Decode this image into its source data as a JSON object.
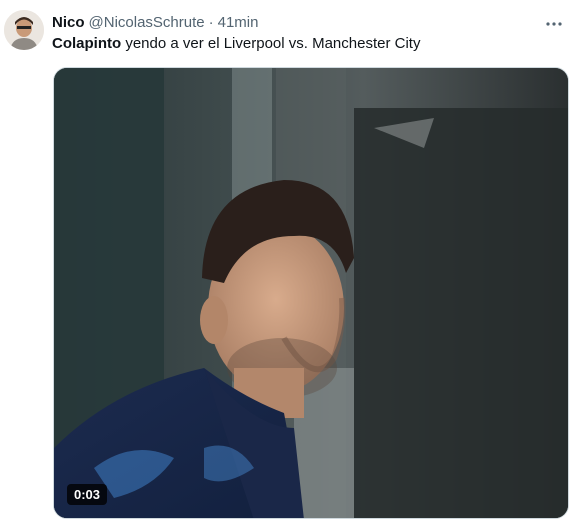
{
  "author": {
    "name": "Nico",
    "handle": "@NicolasSchrute",
    "separator": "·",
    "time": "41min"
  },
  "tweet": {
    "bold_text": "Colapinto",
    "text": " yendo a ver el Liverpool vs. Manchester City"
  },
  "media": {
    "duration": "0:03"
  },
  "icons": {
    "more": "more-horizontal-icon"
  },
  "colors": {
    "text_primary": "#0f1419",
    "text_secondary": "#536471"
  }
}
